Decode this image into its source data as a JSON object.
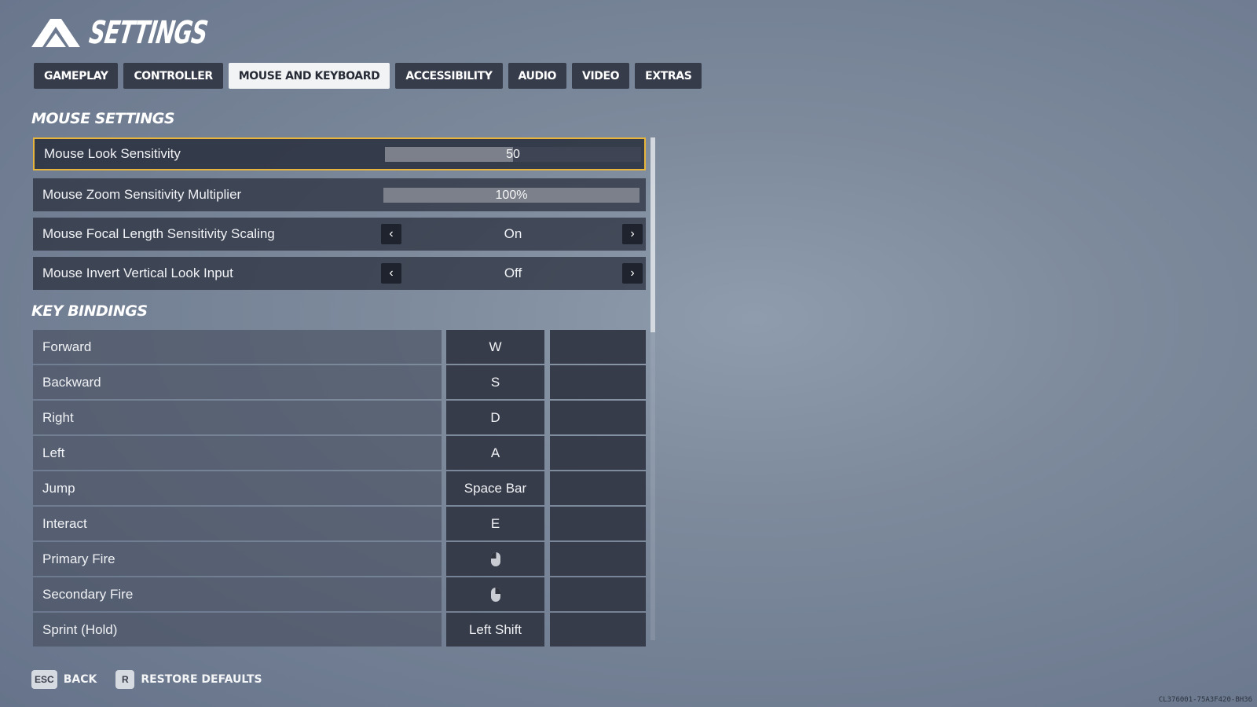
{
  "header": {
    "title": "SETTINGS",
    "logo_icon": "chevron-logo-icon"
  },
  "tabs": [
    {
      "label": "GAMEPLAY",
      "active": false
    },
    {
      "label": "CONTROLLER",
      "active": false
    },
    {
      "label": "MOUSE AND KEYBOARD",
      "active": true
    },
    {
      "label": "ACCESSIBILITY",
      "active": false
    },
    {
      "label": "AUDIO",
      "active": false
    },
    {
      "label": "VIDEO",
      "active": false
    },
    {
      "label": "EXTRAS",
      "active": false
    }
  ],
  "mouse_settings": {
    "title": "MOUSE SETTINGS",
    "items": [
      {
        "label": "Mouse Look Sensitivity",
        "type": "slider",
        "value": "50",
        "fill": 0.5,
        "focused": true
      },
      {
        "label": "Mouse Zoom Sensitivity Multiplier",
        "type": "slider",
        "value": "100%",
        "fill": 1.0,
        "focused": false
      },
      {
        "label": "Mouse Focal Length Sensitivity Scaling",
        "type": "selector",
        "value": "On"
      },
      {
        "label": "Mouse Invert Vertical Look Input",
        "type": "selector",
        "value": "Off"
      }
    ]
  },
  "key_bindings": {
    "title": "KEY BINDINGS",
    "rows": [
      {
        "action": "Forward",
        "key1": "W",
        "key2": ""
      },
      {
        "action": "Backward",
        "key1": "S",
        "key2": ""
      },
      {
        "action": "Right",
        "key1": "D",
        "key2": ""
      },
      {
        "action": "Left",
        "key1": "A",
        "key2": ""
      },
      {
        "action": "Jump",
        "key1": "Space Bar",
        "key2": ""
      },
      {
        "action": "Interact",
        "key1": "E",
        "key2": ""
      },
      {
        "action": "Primary Fire",
        "key1": "",
        "key1_icon": "left-mouse-button-icon",
        "key2": ""
      },
      {
        "action": "Secondary Fire",
        "key1": "",
        "key1_icon": "right-mouse-button-icon",
        "key2": ""
      },
      {
        "action": "Sprint (Hold)",
        "key1": "Left Shift",
        "key2": ""
      }
    ]
  },
  "footer": {
    "back": {
      "key": "ESC",
      "label": "BACK"
    },
    "restore": {
      "key": "R",
      "label": "RESTORE DEFAULTS"
    }
  },
  "build_id": "CL376001-75A3F420-BH36",
  "colors": {
    "focus_border": "#e7b53b",
    "active_tab_bg": "#f2f3f5",
    "panel_dark": "#363c4a"
  },
  "scroll_position": 0
}
